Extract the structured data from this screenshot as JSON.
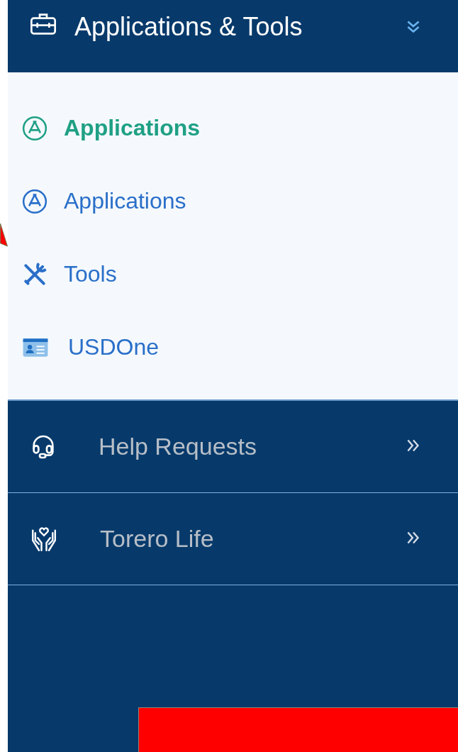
{
  "header": {
    "title": "Applications & Tools",
    "expanded": true
  },
  "submenu": [
    {
      "label": "Applications",
      "kind": "app",
      "selected": true
    },
    {
      "label": "Applications",
      "kind": "app",
      "selected": false
    },
    {
      "label": "Tools",
      "kind": "tools",
      "selected": false
    },
    {
      "label": "USDOne",
      "kind": "card",
      "selected": false
    }
  ],
  "sections": [
    {
      "label": "Help Requests",
      "kind": "headset",
      "expanded": false
    },
    {
      "label": "Torero Life",
      "kind": "hands",
      "expanded": false
    }
  ]
}
